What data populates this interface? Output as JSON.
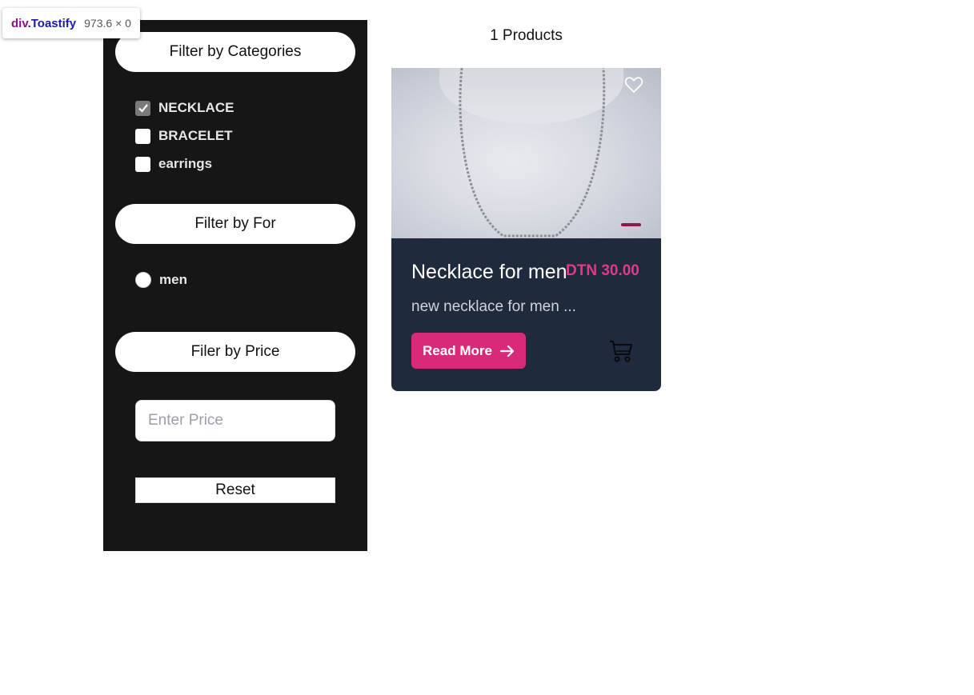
{
  "devtools": {
    "tag": "div",
    "class_name": ".Toastify",
    "dims": "973.6 × 0"
  },
  "sidebar": {
    "categories_header": "Filter by Categories",
    "categories": [
      {
        "label": "NECKLACE",
        "checked": true
      },
      {
        "label": "BRACELET",
        "checked": false
      },
      {
        "label": "earrings",
        "checked": false
      }
    ],
    "for_header": "Filter by For",
    "for_options": [
      {
        "label": "men",
        "selected": false
      }
    ],
    "price_header": "Filer by Price",
    "price_placeholder": "Enter Price",
    "reset_label": "Reset"
  },
  "products": {
    "count_label": "1 Products",
    "items": [
      {
        "title": "Necklace for men",
        "price": "DTN 30.00",
        "description": "new necklace for men ...",
        "read_more_label": "Read More",
        "image_icon": "necklace-photo",
        "favorite_icon": "heart-outline-icon",
        "cart_icon": "cart-icon"
      }
    ]
  },
  "colors": {
    "sidebar_bg": "#161616",
    "card_bg": "#1f2a3c",
    "accent": "#d92a7a",
    "price": "#e2388f"
  }
}
